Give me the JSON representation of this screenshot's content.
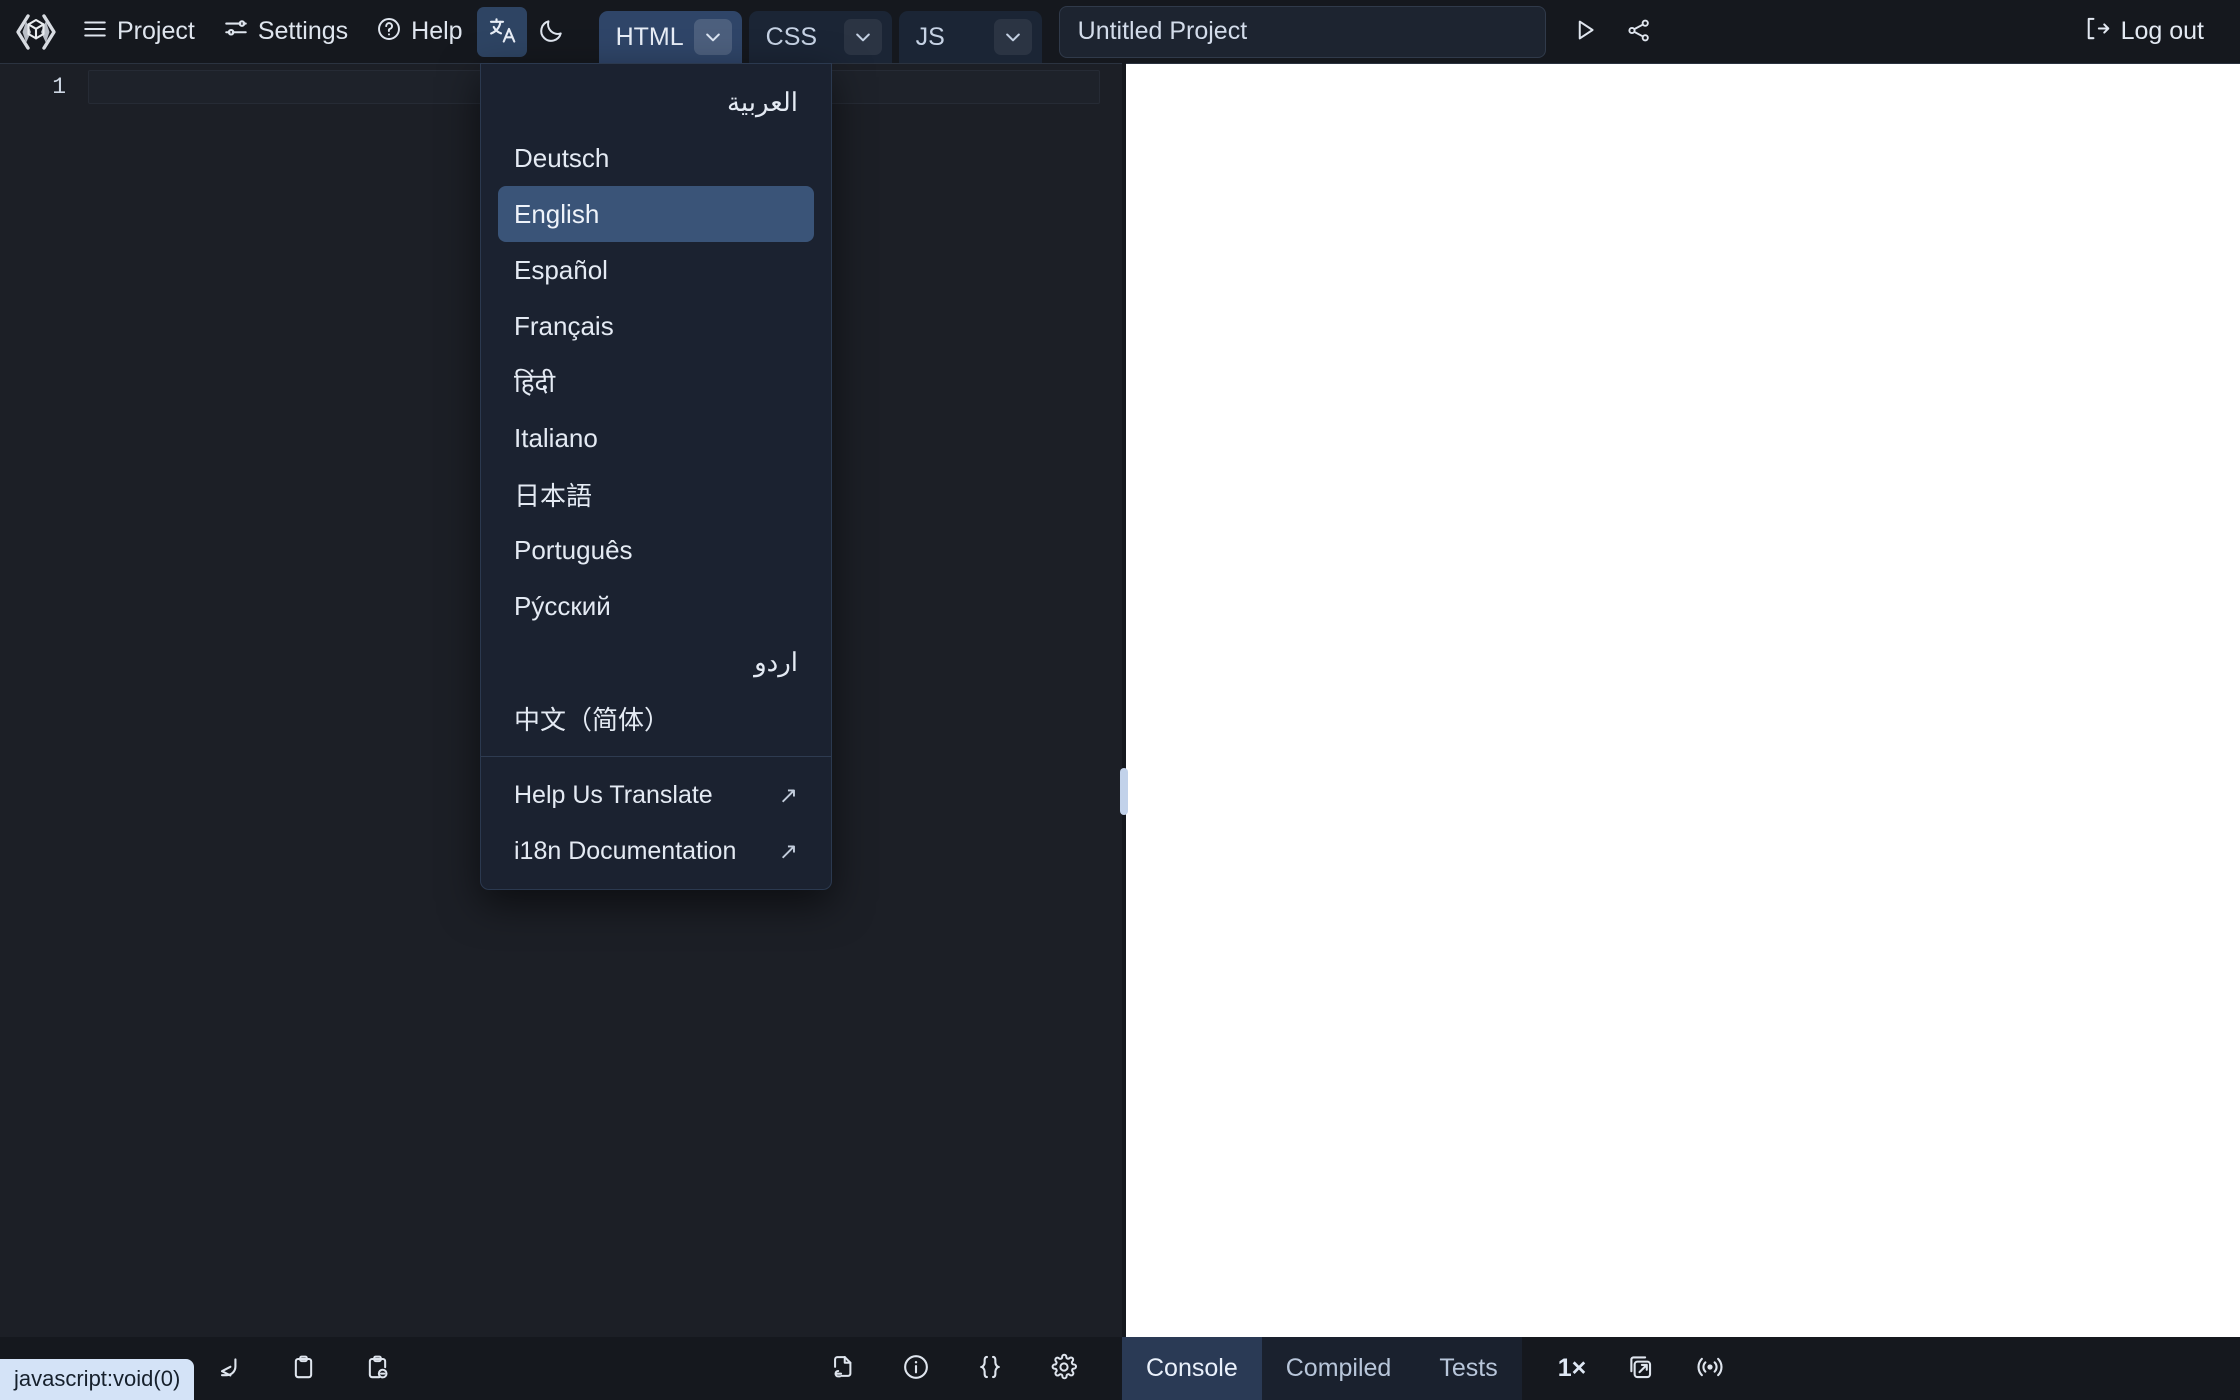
{
  "app": {
    "logo_name": "code-cube-logo",
    "accent_blue": "#2f4568",
    "menu_highlight": "#3a5478",
    "panel_bg": "#1b2230",
    "editor_bg": "#1c1f26",
    "toolbar_bg": "#15181e"
  },
  "toolbar": {
    "project_label": "Project",
    "settings_label": "Settings",
    "help_label": "Help",
    "translate_title": "Language",
    "theme_title": "Dark mode",
    "logout_label": "Log out",
    "run_title": "Run",
    "share_title": "Share"
  },
  "lang_tabs": [
    {
      "label": "HTML",
      "active": true
    },
    {
      "label": "CSS",
      "active": false
    },
    {
      "label": "JS",
      "active": false
    }
  ],
  "project": {
    "title_value": "Untitled Project",
    "title_placeholder": "Untitled Project"
  },
  "editor": {
    "line_numbers": [
      "1"
    ],
    "content": ""
  },
  "language_menu": {
    "open": true,
    "selected": "English",
    "items": [
      {
        "label": "العربية",
        "rtl": true,
        "selected": false
      },
      {
        "label": "Deutsch",
        "rtl": false,
        "selected": false
      },
      {
        "label": "English",
        "rtl": false,
        "selected": true
      },
      {
        "label": "Español",
        "rtl": false,
        "selected": false
      },
      {
        "label": "Français",
        "rtl": false,
        "selected": false
      },
      {
        "label": "हिंदी",
        "rtl": false,
        "selected": false
      },
      {
        "label": "Italiano",
        "rtl": false,
        "selected": false
      },
      {
        "label": "日本語",
        "rtl": false,
        "selected": false
      },
      {
        "label": "Português",
        "rtl": false,
        "selected": false
      },
      {
        "label": "Рýсский",
        "rtl": false,
        "selected": false
      },
      {
        "label": "اردو",
        "rtl": true,
        "selected": false
      },
      {
        "label": "中文（简体）",
        "rtl": false,
        "selected": false
      }
    ],
    "links": [
      {
        "label": "Help Us Translate",
        "external_glyph": "↗"
      },
      {
        "label": "i18n Documentation",
        "external_glyph": "↗"
      }
    ]
  },
  "bottom_bar": {
    "left_icons": [
      {
        "name": "redo-icon",
        "title": "Redo"
      },
      {
        "name": "clipboard-icon",
        "title": "Copy"
      },
      {
        "name": "clipboard-link-icon",
        "title": "Copy link"
      }
    ],
    "mid_icons": [
      {
        "name": "file-link-icon",
        "title": "File link"
      },
      {
        "name": "info-icon",
        "title": "Info"
      },
      {
        "name": "braces-icon",
        "title": "Format"
      },
      {
        "name": "gear-icon",
        "title": "Editor settings"
      }
    ],
    "panel_tabs": [
      {
        "label": "Console",
        "active": true
      },
      {
        "label": "Compiled",
        "active": false
      },
      {
        "label": "Tests",
        "active": false
      }
    ],
    "speed_label": "1×",
    "extra_icons": [
      {
        "name": "open-external-icon",
        "title": "Open preview in new tab"
      },
      {
        "name": "live-broadcast-icon",
        "title": "Live reload"
      }
    ]
  },
  "status_bar": {
    "link_text": "javascript:void(0)"
  }
}
